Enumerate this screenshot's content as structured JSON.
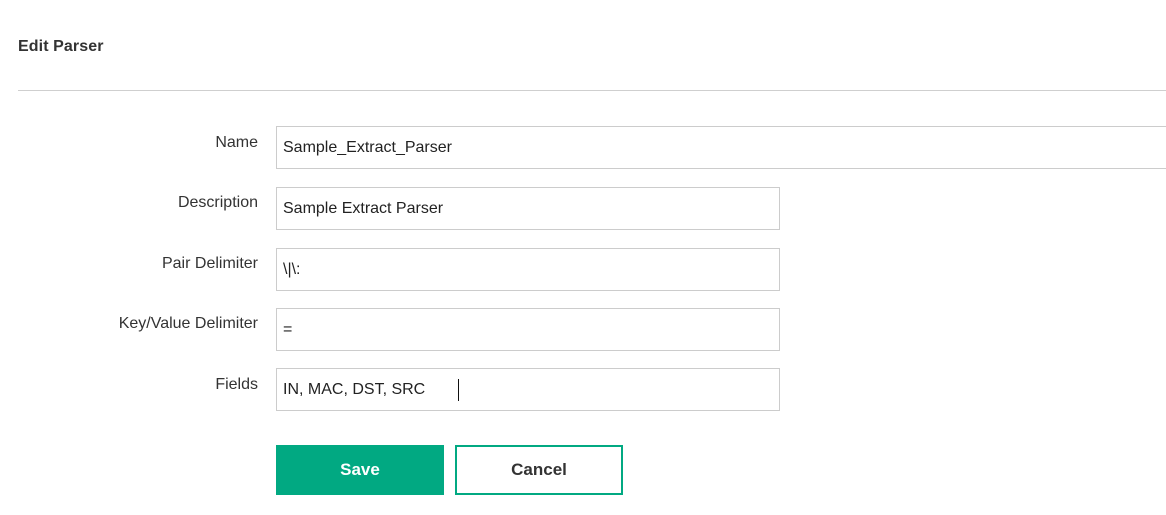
{
  "header": {
    "title": "Edit Parser"
  },
  "form": {
    "name_label": "Name",
    "name_value": "Sample_Extract_Parser",
    "description_label": "Description",
    "description_value": "Sample Extract Parser",
    "pair_delimiter_label": "Pair Delimiter",
    "pair_delimiter_value": "\\|\\:",
    "key_value_delimiter_label": "Key/Value Delimiter",
    "key_value_delimiter_value": "=",
    "fields_label": "Fields",
    "fields_value": "IN, MAC, DST, SRC"
  },
  "actions": {
    "save_label": "Save",
    "cancel_label": "Cancel"
  },
  "colors": {
    "accent": "#01a982",
    "divider": "#cfcfcf",
    "input_border": "#cccccc"
  }
}
